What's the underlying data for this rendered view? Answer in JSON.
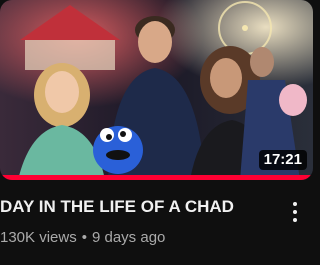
{
  "video": {
    "duration": "17:21",
    "watch_progress": 1.0,
    "title": "DAY IN THE LIFE OF A CHAD",
    "views": "130K views",
    "separator": "•",
    "age": "9 days ago"
  },
  "icons": {
    "menu": "vertical-ellipsis-icon"
  },
  "colors": {
    "background": "#0f0f0f",
    "progress": "#ff0033",
    "title": "#f1f1f1",
    "meta": "#aaaaaa"
  }
}
